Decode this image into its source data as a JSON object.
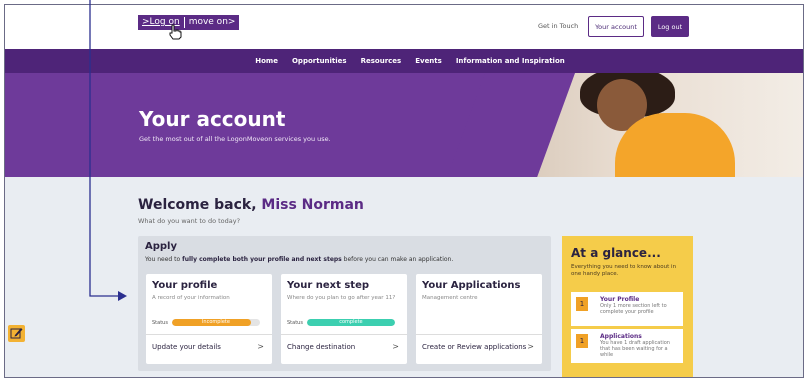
{
  "header": {
    "logo": {
      "part1": ">Log on",
      "part2": "move on>"
    },
    "get_in_touch": "Get in Touch",
    "your_account_button": "Your account",
    "logout_button": "Log out"
  },
  "nav": {
    "items": [
      "Home",
      "Opportunities",
      "Resources",
      "Events",
      "Information and Inspiration"
    ]
  },
  "hero": {
    "title": "Your account",
    "subtitle": "Get the most out of all the LogonMoveon services you use."
  },
  "welcome": {
    "prefix": "Welcome back, ",
    "name": "Miss Norman",
    "subtitle": "What do you want to do today?"
  },
  "apply": {
    "title": "Apply",
    "desc_pre": "You need to ",
    "desc_bold": "fully complete both your profile and next steps",
    "desc_post": " before you can make an application.",
    "cards": [
      {
        "title": "Your profile",
        "subtitle": "A record of your information",
        "status_label": "Status",
        "status_text": "Incomplete",
        "progress": 0.9,
        "bar_color": "#f0a126",
        "link": "Update your details",
        "chevron": ">"
      },
      {
        "title": "Your next step",
        "subtitle": "Where do you plan to go after year 11?",
        "status_label": "Status",
        "status_text": "complete",
        "progress": 1.0,
        "bar_color": "#3ccfb0",
        "link": "Change destination",
        "chevron": ">"
      },
      {
        "title": "Your Applications",
        "subtitle": "Management centre",
        "link": "Create or Review applications",
        "chevron": ">"
      }
    ]
  },
  "glance": {
    "title": "At a glance...",
    "subtitle": "Everything you need to know about in one handy place.",
    "items": [
      {
        "count": "1",
        "title": "Your Profile",
        "text": "Only 1 more section left to complete your profile"
      },
      {
        "count": "1",
        "title": "Applications",
        "text": "You have 1 draft application that has been waiting for a while"
      }
    ]
  },
  "colors": {
    "brand_purple": "#5b2b85",
    "nav_purple": "#4e2478",
    "hero_purple": "#6e3a9a",
    "glance_yellow": "#f5cc4a",
    "annotation_blue": "#2b2f8f"
  },
  "icons": {
    "edit": "edit-icon",
    "pointer": "hand-cursor-icon",
    "arrow": "annotation-arrow-icon"
  }
}
